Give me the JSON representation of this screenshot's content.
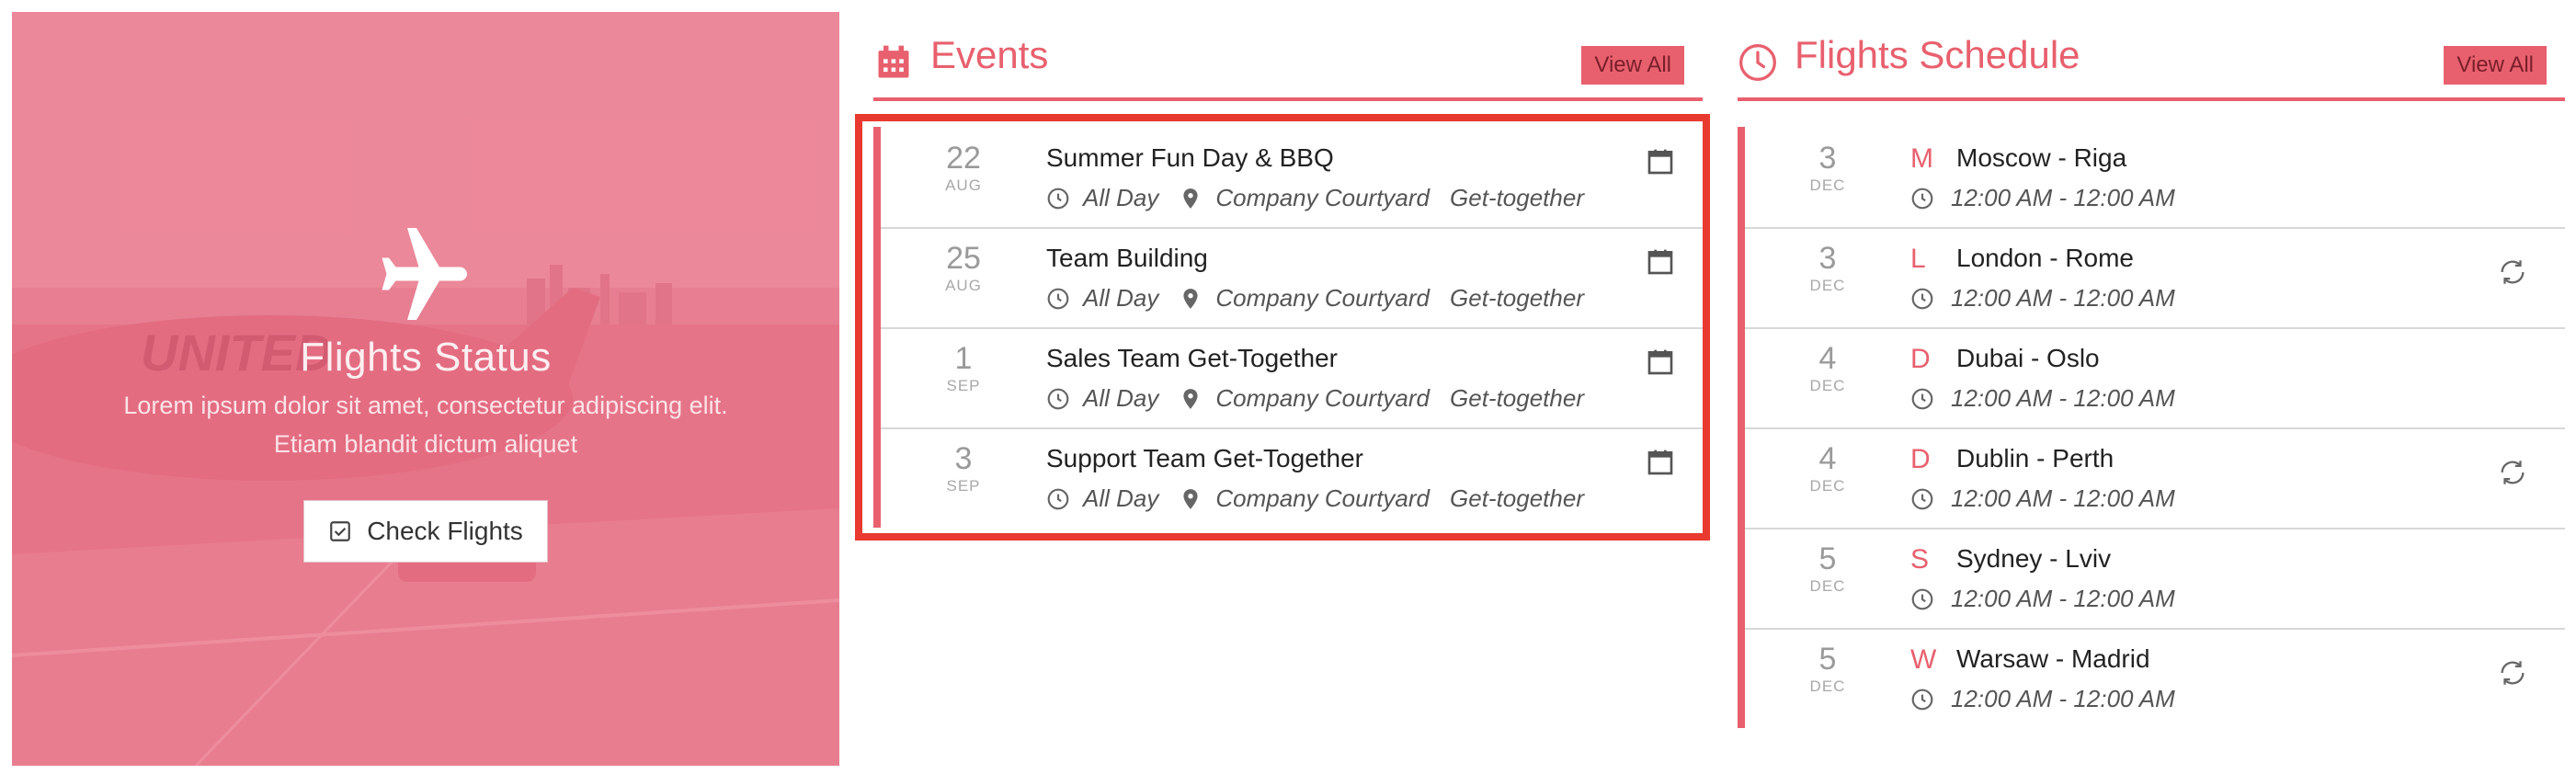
{
  "hero": {
    "title": "Flights Status",
    "description": "Lorem ipsum dolor sit amet, consectetur adipiscing elit. Etiam blandit dictum aliquet",
    "button_label": "Check Flights",
    "overlay_color": "#e8606e"
  },
  "events": {
    "title": "Events",
    "view_all": "View All",
    "items": [
      {
        "day": "22",
        "month": "AUG",
        "title": "Summer Fun Day & BBQ",
        "time": "All Day",
        "location": "Company Courtyard",
        "category": "Get-together"
      },
      {
        "day": "25",
        "month": "AUG",
        "title": "Team Building",
        "time": "All Day",
        "location": "Company Courtyard",
        "category": "Get-together"
      },
      {
        "day": "1",
        "month": "SEP",
        "title": "Sales Team Get-Together",
        "time": "All Day",
        "location": "Company Courtyard",
        "category": "Get-together"
      },
      {
        "day": "3",
        "month": "SEP",
        "title": "Support Team Get-Together",
        "time": "All Day",
        "location": "Company Courtyard",
        "category": "Get-together"
      }
    ]
  },
  "flights": {
    "title": "Flights Schedule",
    "view_all": "View All",
    "items": [
      {
        "day": "3",
        "month": "DEC",
        "letter": "M",
        "route": "Moscow - Riga",
        "time": "12:00 AM - 12:00 AM",
        "recurring": false
      },
      {
        "day": "3",
        "month": "DEC",
        "letter": "L",
        "route": "London - Rome",
        "time": "12:00 AM - 12:00 AM",
        "recurring": true
      },
      {
        "day": "4",
        "month": "DEC",
        "letter": "D",
        "route": "Dubai - Oslo",
        "time": "12:00 AM - 12:00 AM",
        "recurring": false
      },
      {
        "day": "4",
        "month": "DEC",
        "letter": "D",
        "route": "Dublin - Perth",
        "time": "12:00 AM - 12:00 AM",
        "recurring": true
      },
      {
        "day": "5",
        "month": "DEC",
        "letter": "S",
        "route": "Sydney - Lviv",
        "time": "12:00 AM - 12:00 AM",
        "recurring": false
      },
      {
        "day": "5",
        "month": "DEC",
        "letter": "W",
        "route": "Warsaw - Madrid",
        "time": "12:00 AM - 12:00 AM",
        "recurring": true
      }
    ]
  },
  "colors": {
    "accent": "#e8606e",
    "highlight": "#e83a2e",
    "divider": "#d8d8d8"
  }
}
